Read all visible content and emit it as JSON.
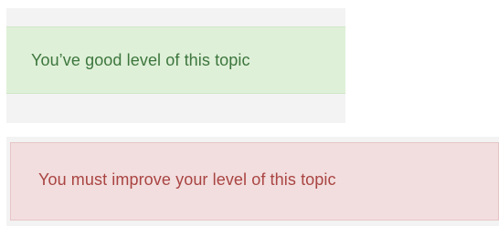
{
  "alerts": {
    "success": {
      "message": "You’ve good level of this topic",
      "color": "#3c763d",
      "background": "#dff0d8"
    },
    "danger": {
      "message": "You must improve your level of this topic",
      "color": "#a94442",
      "background": "#f2dede"
    }
  }
}
